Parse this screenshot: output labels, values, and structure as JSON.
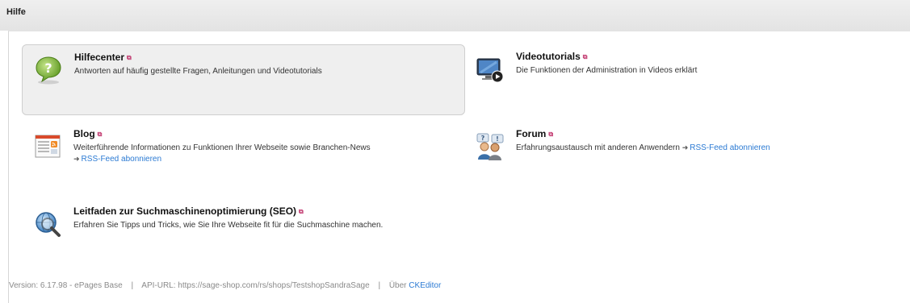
{
  "header": {
    "title": "Hilfe"
  },
  "tiles": [
    {
      "title": "Hilfecenter",
      "desc": "Antworten auf häufig gestellte Fragen, Anleitungen und Videotutorials",
      "icon": "question-bubble-icon"
    },
    {
      "title": "Videotutorials",
      "desc": "Die Funktionen der Administration in Videos erklärt",
      "icon": "monitor-play-icon"
    },
    {
      "title": "Blog",
      "desc": "Weiterführende Informationen zu Funktionen Ihrer Webseite sowie Branchen-News",
      "link": "RSS-Feed abonnieren",
      "icon": "blog-document-icon"
    },
    {
      "title": "Forum",
      "desc": "Erfahrungsaustausch mit anderen Anwendern",
      "link": "RSS-Feed abonnieren",
      "icon": "forum-users-icon"
    },
    {
      "title": "Leitfaden zur Suchmaschinenoptimierung (SEO)",
      "desc": "Erfahren Sie Tipps und Tricks, wie Sie Ihre Webseite fit für die Suchmaschine machen.",
      "icon": "magnifier-globe-icon"
    }
  ],
  "external_marker": "⧉",
  "link_arrow": "➜",
  "footer": {
    "version": "Version: 6.17.98 - ePages Base",
    "separator": "|",
    "api_url": "API-URL: https://sage-shop.com/rs/shops/TestshopSandraSage",
    "about_prefix": "Über",
    "about_link": "CKEditor"
  },
  "colors": {
    "link": "#2b7ad3",
    "external_marker": "#c0336b",
    "highlight_bg": "#efefef"
  }
}
